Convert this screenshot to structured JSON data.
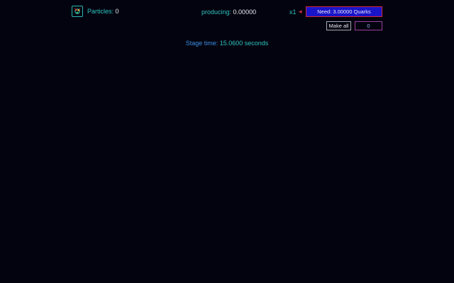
{
  "header": {
    "particles_label": "Particles:",
    "particles_value": "0",
    "producing_label": "producing:",
    "producing_value": "0.00000",
    "multiplier": "x1",
    "arrow": "◂",
    "need_button": "Need: 3.00000 Quarks",
    "make_all_button": "Make all",
    "count_value": "0",
    "icon": "particle-icon"
  },
  "stage": {
    "label": "Stage time:",
    "value": "15.0600 seconds"
  },
  "colors": {
    "background": "#03030f",
    "cyan": "#2ec4c0",
    "need_button_bg": "#1a14c8",
    "need_button_border": "#d22a3c",
    "count_border": "#9a3fa0"
  }
}
